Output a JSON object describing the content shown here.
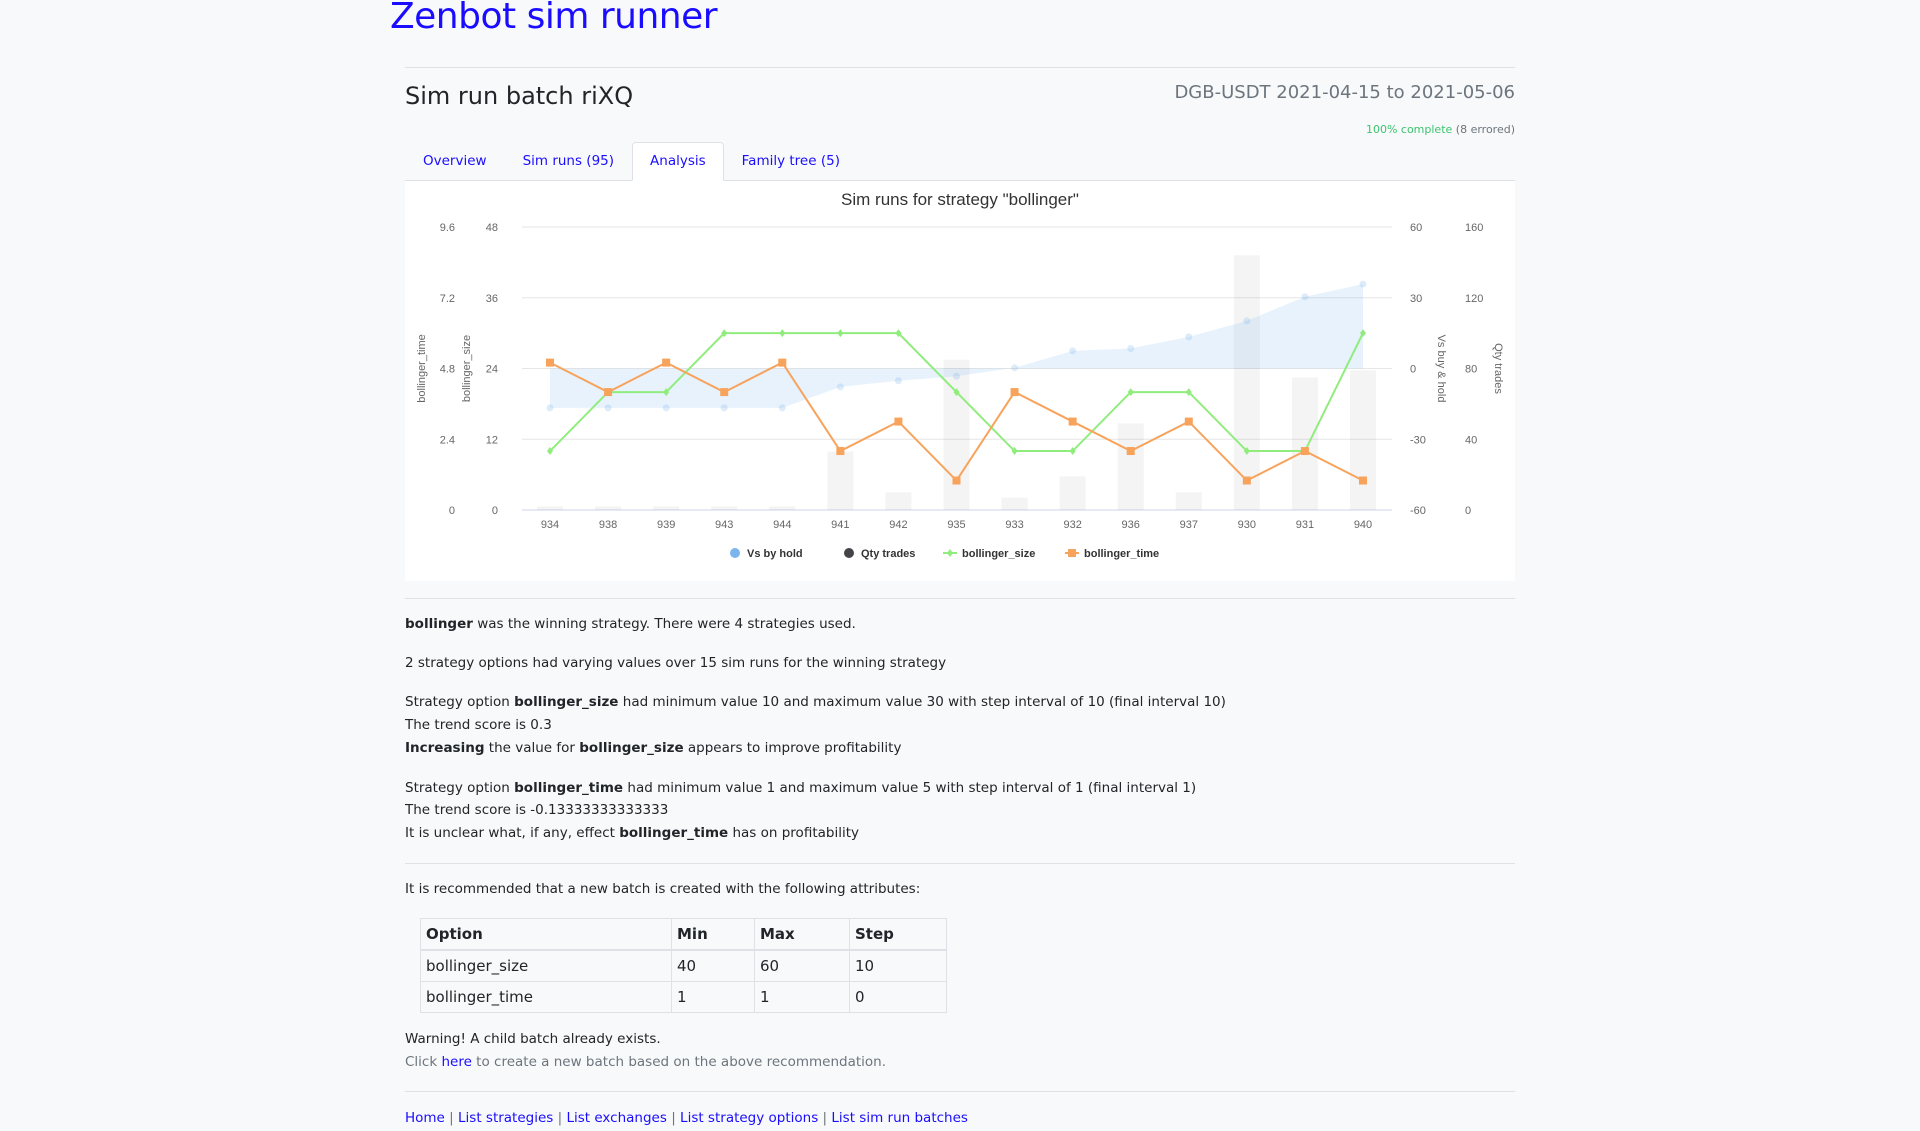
{
  "site_title": "Zenbot sim runner",
  "batch": {
    "title": "Sim run batch riXQ",
    "range": "DGB-USDT 2021-04-15 to 2021-05-06",
    "progress_complete": "100% complete",
    "progress_errored": "(8 errored)"
  },
  "tabs": [
    {
      "label": "Overview"
    },
    {
      "label": "Sim runs (95)"
    },
    {
      "label": "Analysis",
      "active": true
    },
    {
      "label": "Family tree (5)"
    }
  ],
  "chart_data": {
    "type": "line",
    "title": "Sim runs for strategy \"bollinger\"",
    "categories": [
      "934",
      "938",
      "939",
      "943",
      "944",
      "941",
      "942",
      "935",
      "933",
      "932",
      "936",
      "937",
      "930",
      "931",
      "940"
    ],
    "axes": {
      "bollinger_time": {
        "title": "bollinger_time",
        "range": [
          0,
          9.6
        ],
        "ticks": [
          "0",
          "2.4",
          "4.8",
          "7.2",
          "9.6"
        ],
        "side": "left"
      },
      "bollinger_size": {
        "title": "bollinger_size",
        "range": [
          0,
          48
        ],
        "ticks": [
          "0",
          "12",
          "24",
          "36",
          "48"
        ],
        "side": "left"
      },
      "vs_hold": {
        "title": "Vs buy & hold",
        "range": [
          -60,
          60
        ],
        "ticks": [
          "-60",
          "-30",
          "0",
          "30",
          "60"
        ],
        "side": "right"
      },
      "qty_trades": {
        "title": "Qty trades",
        "range": [
          0,
          160
        ],
        "ticks": [
          "0",
          "40",
          "80",
          "120",
          "160"
        ],
        "side": "right"
      }
    },
    "series": [
      {
        "name": "Vs by hold",
        "type": "area",
        "axis": "vs_hold",
        "color": "#7cb5ec",
        "values": [
          -16.7,
          -16.7,
          -16.7,
          -16.7,
          -16.7,
          -7.8,
          -5.2,
          -3.3,
          0.3,
          7.5,
          8.5,
          13.4,
          20.2,
          30.4,
          35.8
        ]
      },
      {
        "name": "Qty trades",
        "type": "bar",
        "axis": "qty_trades",
        "color": "#434348",
        "values": [
          2,
          2,
          2,
          2,
          2,
          33,
          10,
          85,
          7,
          19,
          49,
          10,
          144,
          75,
          79
        ]
      },
      {
        "name": "bollinger_size",
        "type": "line",
        "axis": "bollinger_size",
        "color": "#90ed7d",
        "values": [
          10,
          20,
          20,
          30,
          30,
          30,
          30,
          20,
          10,
          10,
          20,
          20,
          10,
          10,
          30
        ]
      },
      {
        "name": "bollinger_time",
        "type": "line",
        "axis": "bollinger_time",
        "color": "#f7a35c",
        "values": [
          5,
          4,
          5,
          4,
          5,
          2,
          3,
          1,
          4,
          3,
          2,
          3,
          1,
          2,
          1
        ]
      }
    ],
    "legend": "bottom-center",
    "grid": true
  },
  "analysis": {
    "winner_name": "bollinger",
    "winner_text": " was the winning strategy. There were 4 strategies used.",
    "varying_text": "2 strategy options had varying values over 15 sim runs for the winning strategy",
    "options": [
      {
        "prefix": "Strategy option ",
        "name": "bollinger_size",
        "range_text": " had minimum value 10 and maximum value 30 with step interval of 10 (final interval 10)",
        "trend": "The trend score is 0.3",
        "verdict_bold": "Increasing",
        "verdict_mid": " the value for ",
        "verdict_suffix": " appears to improve profitability"
      },
      {
        "prefix": "Strategy option ",
        "name": "bollinger_time",
        "range_text": " had minimum value 1 and maximum value 5 with step interval of 1 (final interval 1)",
        "trend": "The trend score is -0.13333333333333",
        "verdict_prefix": "It is unclear what, if any, effect ",
        "verdict_suffix": " has on profitability"
      }
    ]
  },
  "recommendation": {
    "intro": "It is recommended that a new batch is created with the following attributes:",
    "headers": [
      "Option",
      "Min",
      "Max",
      "Step"
    ],
    "rows": [
      [
        "bollinger_size",
        "40",
        "60",
        "10"
      ],
      [
        "bollinger_time",
        "1",
        "1",
        "0"
      ]
    ],
    "warning": "Warning! A child batch already exists.",
    "click_prefix": "Click ",
    "click_link": "here",
    "click_suffix": " to create a new batch based on the above recommendation."
  },
  "footer": {
    "links": [
      "Home",
      "List strategies",
      "List exchanges",
      "List strategy options",
      "List sim run batches"
    ],
    "separator": " | "
  }
}
